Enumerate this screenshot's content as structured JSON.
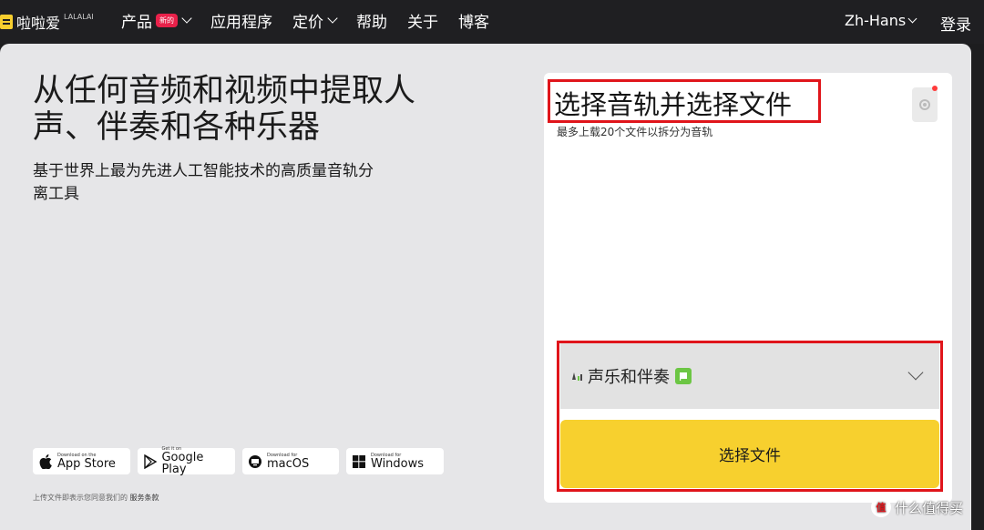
{
  "nav": {
    "logo_text": "啦啦爱",
    "logo_sub": "LALALAI",
    "items": [
      {
        "label": "产品",
        "badge": "新的",
        "dropdown": true
      },
      {
        "label": "应用程序"
      },
      {
        "label": "定价",
        "dropdown": true
      },
      {
        "label": "帮助"
      },
      {
        "label": "关于"
      },
      {
        "label": "博客"
      }
    ],
    "language": "Zh-Hans",
    "login": "登录"
  },
  "hero": {
    "title": "从任何音频和视频中提取人声、伴奏和各种乐器",
    "subtitle": "基于世界上最为先进人工智能技术的高质量音轨分离工具"
  },
  "stores": [
    {
      "small": "Download on the",
      "big": "App Store",
      "icon": "apple-icon"
    },
    {
      "small": "Get it on",
      "big": "Google Play",
      "icon": "google-play-icon"
    },
    {
      "small": "Download for",
      "big": "macOS",
      "icon": "macos-icon"
    },
    {
      "small": "Download for",
      "big": "Windows",
      "icon": "windows-icon"
    }
  ],
  "terms": {
    "text": "上传文件即表示您同意我们的",
    "link": "服务条款"
  },
  "panel": {
    "title": "选择音轨并选择文件",
    "note": "最多上载20个文件以拆分为音轨",
    "track_option": "声乐和伴奏",
    "choose_button": "选择文件"
  },
  "watermark": {
    "logo": "值",
    "text": "什么值得买"
  },
  "colors": {
    "accent_yellow": "#f7d02e",
    "highlight_red": "#e0151b",
    "badge_red": "#e8214a",
    "tag_green": "#6cc644"
  }
}
